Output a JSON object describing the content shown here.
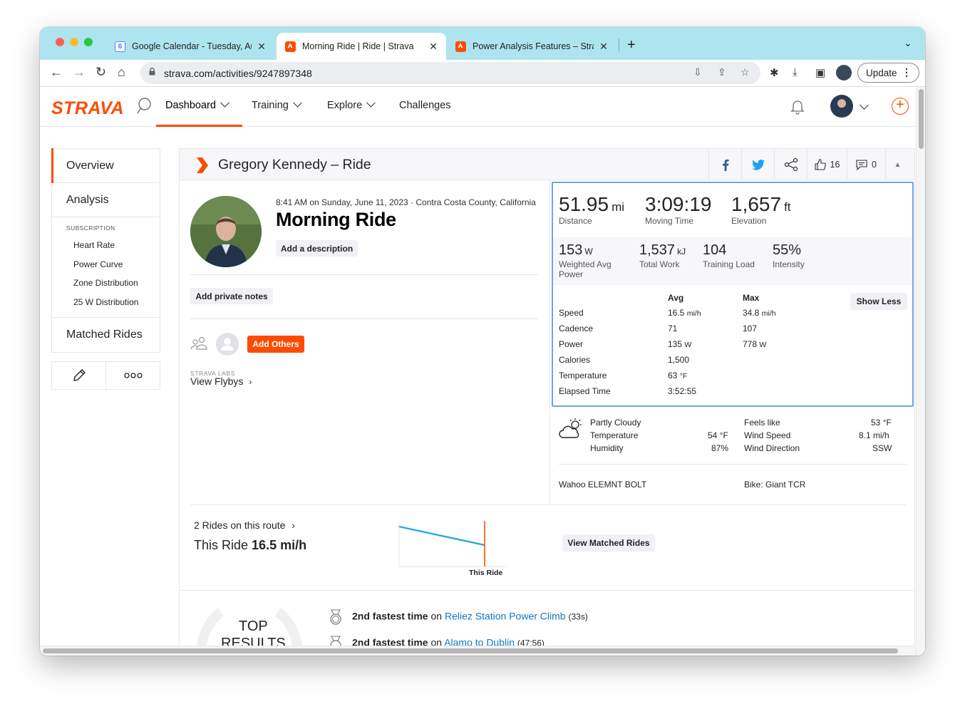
{
  "browser": {
    "tabs": [
      {
        "title": "Google Calendar - Tuesday, Au",
        "favicon": "google-calendar-icon",
        "favicon_text": "6"
      },
      {
        "title": "Morning Ride | Ride | Strava",
        "favicon": "strava-icon"
      },
      {
        "title": "Power Analysis Features – Stra",
        "favicon": "strava-icon"
      }
    ],
    "url": "strava.com/activities/9247897348",
    "update_label": "Update"
  },
  "nav": {
    "logo": "STRAVA",
    "items": [
      "Dashboard",
      "Training",
      "Explore",
      "Challenges"
    ]
  },
  "sidebar": {
    "overview": "Overview",
    "analysis": "Analysis",
    "subscription_caption": "SUBSCRIPTION",
    "sub_items": [
      "Heart Rate",
      "Power Curve",
      "Zone Distribution",
      "25 W Distribution"
    ],
    "matched_rides": "Matched Rides"
  },
  "activity": {
    "athlete_title": "Gregory Kennedy – Ride",
    "kudos_count": "16",
    "comment_count": "0",
    "meta": "8:41 AM on Sunday, June 11, 2023 · Contra Costa County, California",
    "name": "Morning Ride",
    "add_description": "Add a description",
    "add_private_notes": "Add private notes",
    "add_others": "Add Others",
    "labs_caption": "STRAVA LABS",
    "view_flybys": "View Flybys"
  },
  "stats": {
    "primary": [
      {
        "value": "51.95",
        "unit": "mi",
        "label": "Distance"
      },
      {
        "value": "3:09:19",
        "unit": "",
        "label": "Moving Time"
      },
      {
        "value": "1,657",
        "unit": "ft",
        "label": "Elevation"
      }
    ],
    "secondary": [
      {
        "value": "153",
        "unit": "W",
        "label_1": "Weighted Avg",
        "label_2": "Power"
      },
      {
        "value": "1,537",
        "unit": "kJ",
        "label_1": "Total Work",
        "label_2": ""
      },
      {
        "value": "104",
        "unit": "",
        "label_1": "Training Load",
        "label_2": ""
      },
      {
        "value": "55%",
        "unit": "",
        "label_1": "Intensity",
        "label_2": ""
      }
    ],
    "table_headers": {
      "avg": "Avg",
      "max": "Max"
    },
    "rows": [
      {
        "label": "Speed",
        "avg": "16.5",
        "avg_unit": "mi/h",
        "max": "34.8",
        "max_unit": "mi/h"
      },
      {
        "label": "Cadence",
        "avg": "71",
        "avg_unit": "",
        "max": "107",
        "max_unit": ""
      },
      {
        "label": "Power",
        "avg": "135",
        "avg_unit": "W",
        "max": "778",
        "max_unit": "W"
      },
      {
        "label": "Calories",
        "avg": "1,500",
        "avg_unit": "",
        "max": "",
        "max_unit": ""
      },
      {
        "label": "Temperature",
        "avg": "63",
        "avg_unit": "°F",
        "max": "",
        "max_unit": ""
      },
      {
        "label": "Elapsed Time",
        "avg": "3:52:55",
        "avg_unit": "",
        "max": "",
        "max_unit": ""
      }
    ],
    "show_less": "Show Less"
  },
  "weather": {
    "condition": "Partly Cloudy",
    "temperature_label": "Temperature",
    "temperature": "54 °F",
    "humidity_label": "Humidity",
    "humidity": "87%",
    "feels_like_label": "Feels like",
    "feels_like": "53 °F",
    "wind_speed_label": "Wind Speed",
    "wind_speed": "8.1 mi/h",
    "wind_direction_label": "Wind Direction",
    "wind_direction": "SSW"
  },
  "gear": {
    "device": "Wahoo ELEMNT BOLT",
    "bike": "Bike: Giant TCR"
  },
  "matched": {
    "rides_link": "2 Rides on this route",
    "this_ride_prefix": "This Ride",
    "this_ride_value": "16.5 mi/h",
    "chart_caption": "This Ride",
    "view_button": "View Matched Rides",
    "colors": {
      "line": "#2ea7e0",
      "marker": "#fc4c02"
    }
  },
  "results": {
    "badge_line1": "TOP",
    "badge_line2": "RESULTS",
    "items": [
      {
        "rank_text": "2nd fastest time",
        "joiner": "on",
        "segment": "Reliez Station Power Climb",
        "time": "(33s)"
      },
      {
        "rank_text": "2nd fastest time",
        "joiner": "on",
        "segment": "Alamo to Dublin",
        "time": "(47:56)"
      }
    ]
  },
  "colors": {
    "brand": "#fc4c02",
    "highlight": "#73a2eb",
    "link": "#1078c4"
  }
}
